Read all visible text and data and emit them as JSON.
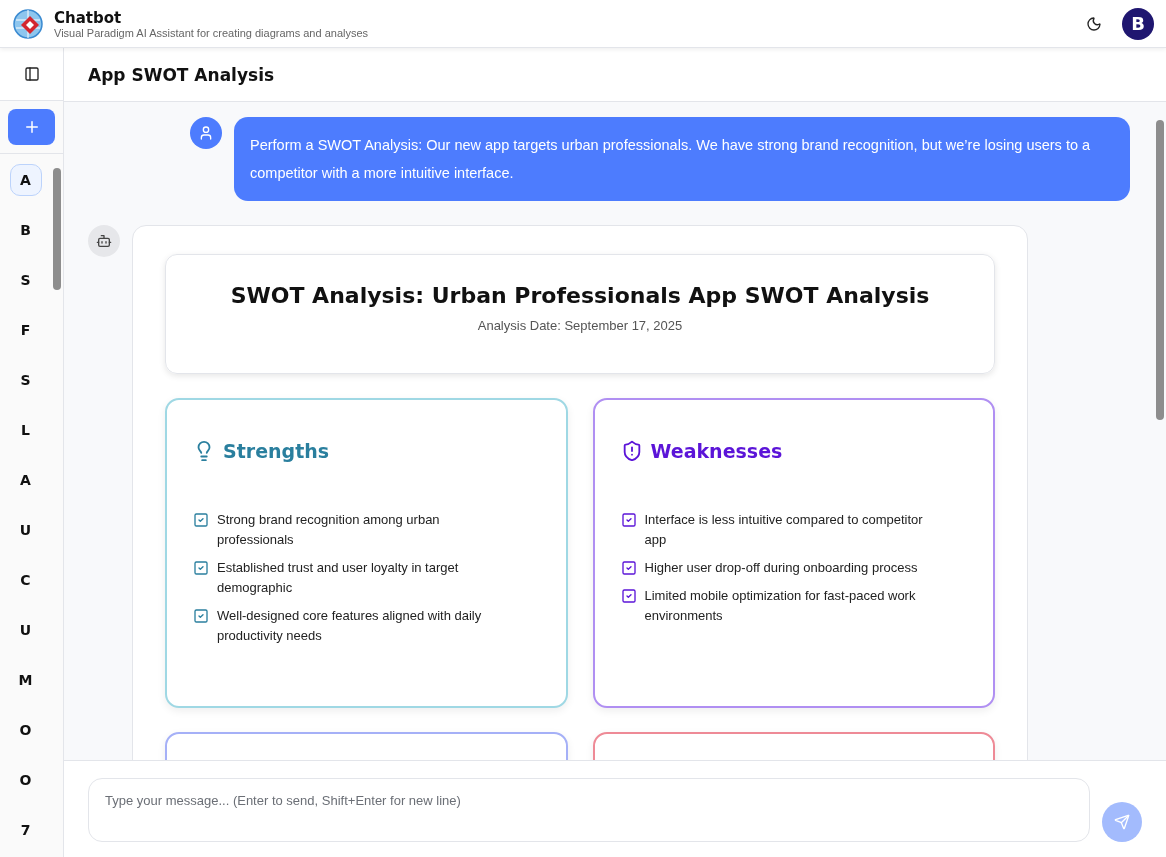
{
  "header": {
    "title": "Chatbot",
    "subtitle": "Visual Paradigm AI Assistant for creating diagrams and analyses",
    "avatar": "B"
  },
  "sidebar": {
    "items": [
      {
        "label": "A",
        "selected": true
      },
      {
        "label": "B",
        "selected": false
      },
      {
        "label": "S",
        "selected": false
      },
      {
        "label": "F",
        "selected": false
      },
      {
        "label": "S",
        "selected": false
      },
      {
        "label": "L",
        "selected": false
      },
      {
        "label": "A",
        "selected": false
      },
      {
        "label": "U",
        "selected": false
      },
      {
        "label": "C",
        "selected": false
      },
      {
        "label": "U",
        "selected": false
      },
      {
        "label": "M",
        "selected": false
      },
      {
        "label": "O",
        "selected": false
      },
      {
        "label": "O",
        "selected": false
      },
      {
        "label": "7",
        "selected": false
      }
    ]
  },
  "conversation": {
    "title": "App SWOT Analysis"
  },
  "messages": [
    {
      "kind": "user",
      "text": "Perform a SWOT Analysis: Our new app targets urban professionals. We have strong brand recognition, but we’re losing users to a competitor with a more intuitive interface."
    },
    {
      "kind": "bot",
      "report": {
        "title": "SWOT Analysis: Urban Professionals App SWOT Analysis",
        "date": "Analysis Date: September 17, 2025",
        "quadrants": [
          {
            "kind": "strengths",
            "title": "Strengths",
            "color": "#9fd8e4",
            "items": [
              "Strong brand recognition among urban professionals",
              "Established trust and user loyalty in target demographic",
              "Well-designed core features aligned with daily productivity needs"
            ]
          },
          {
            "kind": "weaknesses",
            "title": "Weaknesses",
            "color": "#b08ff2",
            "items": [
              "Interface is less intuitive compared to competitor app",
              "Higher user drop-off during onboarding process",
              "Limited mobile optimization for fast-paced work environments"
            ]
          },
          {
            "color": "#a5b0f7"
          },
          {
            "color": "#ee8a96"
          }
        ]
      }
    }
  ],
  "composer": {
    "placeholder": "Type your message... (Enter to send, Shift+Enter for new line)",
    "send_disabled": true
  }
}
